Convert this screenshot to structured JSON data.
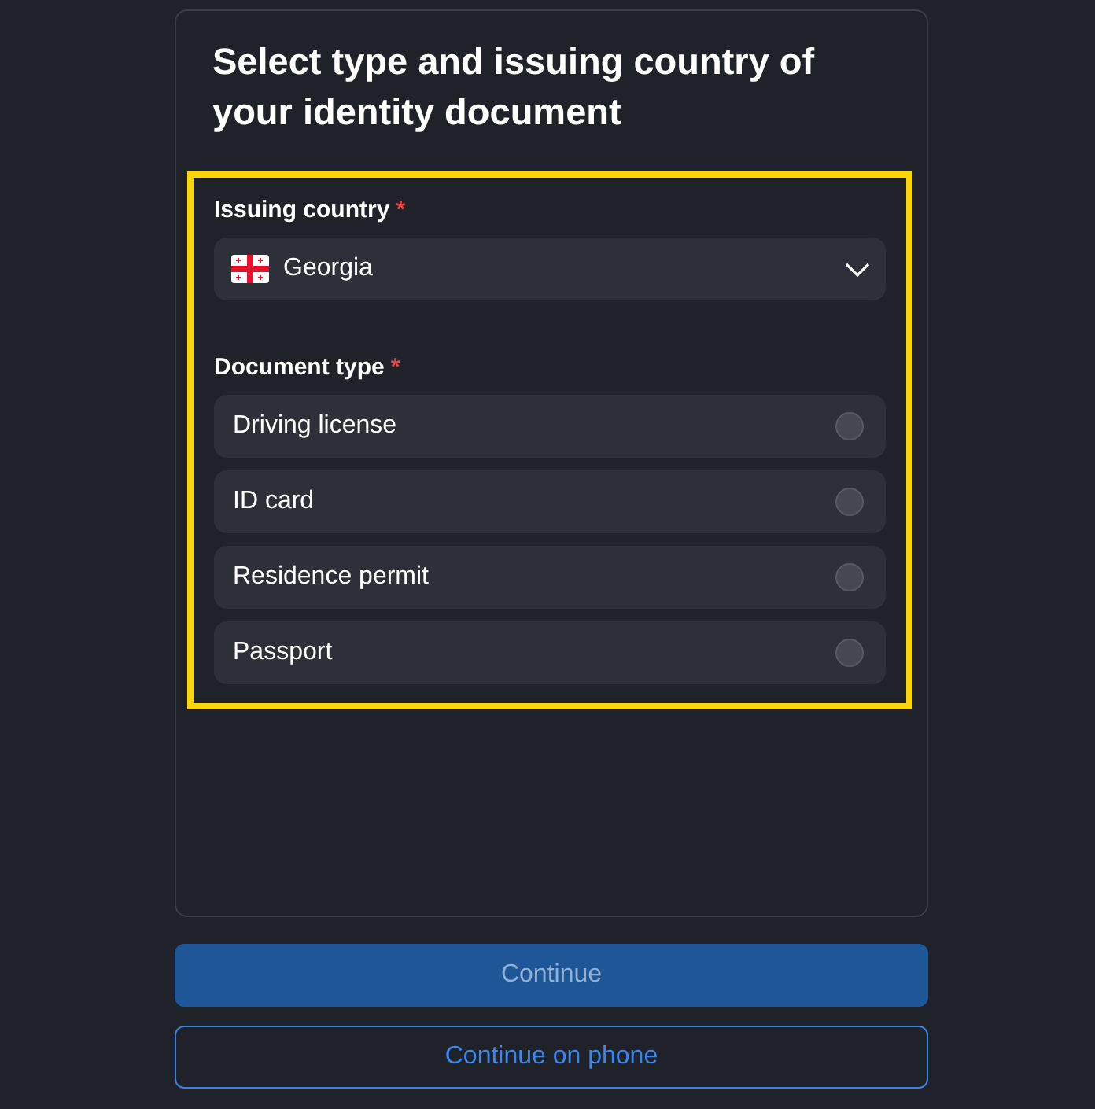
{
  "title": "Select type and issuing country of your identity document",
  "form": {
    "highlighted": true,
    "country": {
      "label": "Issuing country",
      "asterisk": "*",
      "value": "Georgia"
    },
    "document_type": {
      "label": "Document type",
      "asterisk": "*",
      "options": [
        {
          "label": "Driving license",
          "selected": false
        },
        {
          "label": "ID card",
          "selected": false
        },
        {
          "label": "Residence permit",
          "selected": false
        },
        {
          "label": "Passport",
          "selected": false
        }
      ]
    }
  },
  "buttons": [
    {
      "label": "Continue",
      "kind": "primary",
      "disabled": true
    },
    {
      "label": "Continue on phone",
      "kind": "outline",
      "disabled": false
    }
  ]
}
